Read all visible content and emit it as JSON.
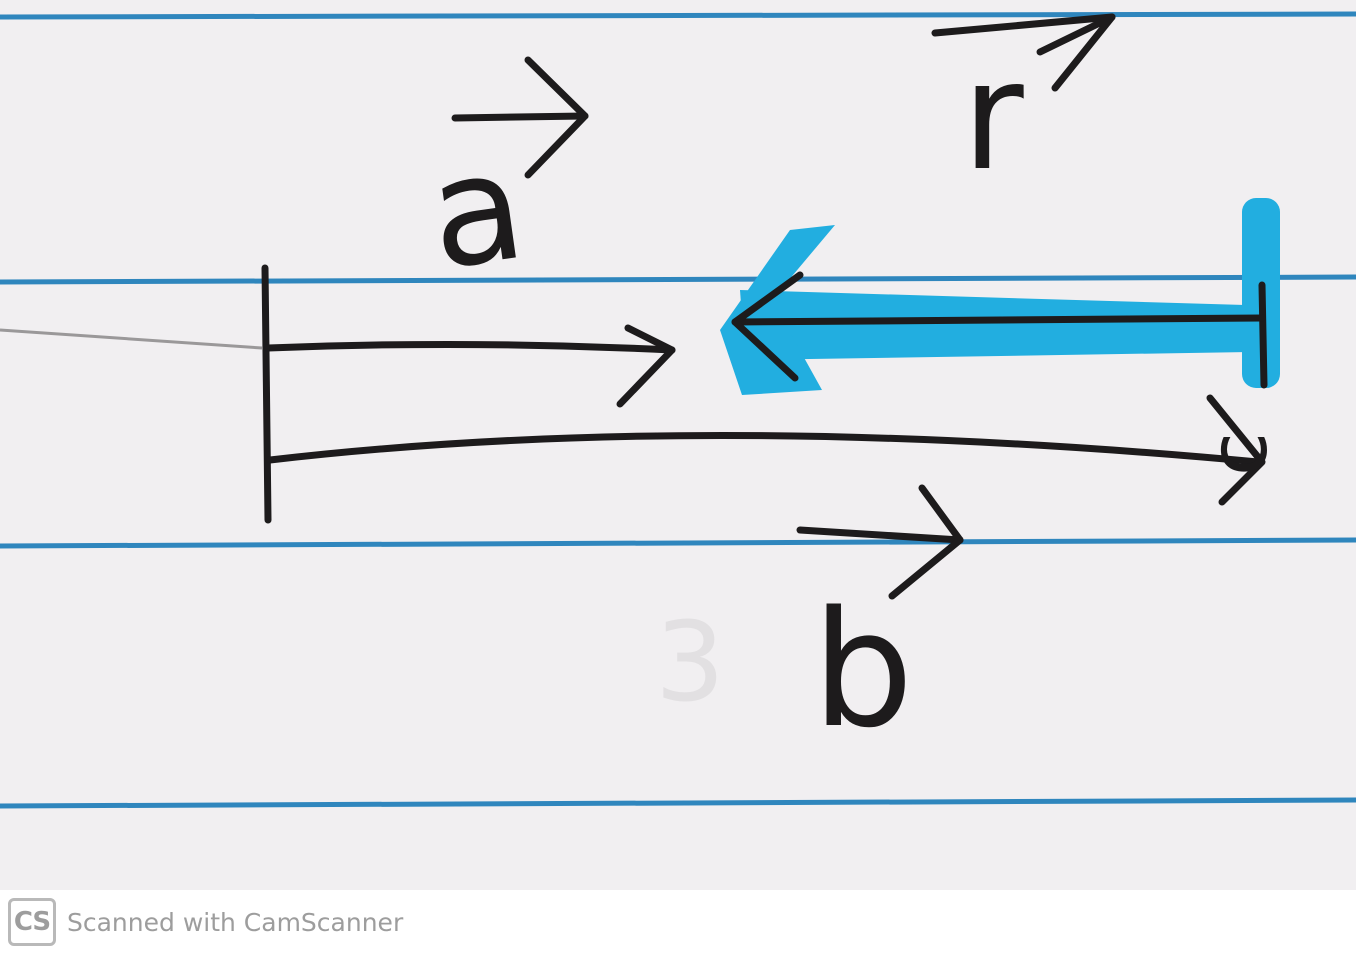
{
  "diagram": {
    "labels": {
      "a": "a",
      "b": "b",
      "r": "r",
      "c": "c",
      "faint_digit": "3"
    },
    "colors": {
      "paper": "#f1eff1",
      "rule_line": "#2f86bd",
      "ink": "#1d1b1c",
      "highlight": "#22aee0"
    }
  },
  "footer": {
    "logo_text": "CS",
    "text": "Scanned with CamScanner"
  }
}
